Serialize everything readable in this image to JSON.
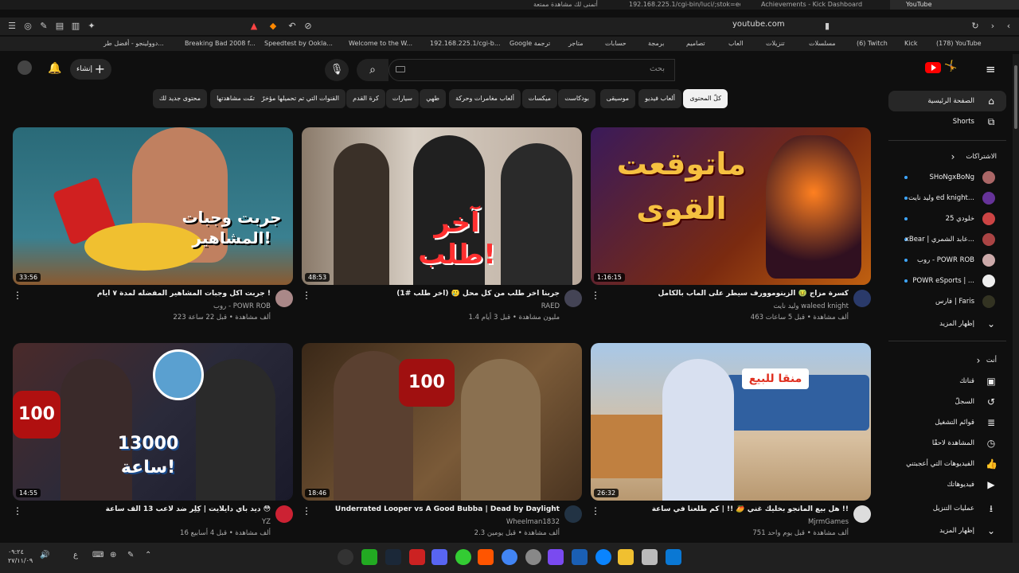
{
  "browser": {
    "tabs": [
      {
        "label": "192.168.225.1/cgi-bin/luci/;stok=ed3",
        "active": false
      },
      {
        "label": "أتمنى لك مشاهدة ممتعة",
        "active": false
      },
      {
        "label": "Achievements - Kick Dashboard",
        "active": false
      },
      {
        "label": "YouTube",
        "active": true
      }
    ],
    "url": "youtube.com",
    "bookmarks": [
      "(178) YouTube",
      "Kick",
      "(6) Twitch",
      "مسلسلات",
      "تنزيلات",
      "العاب",
      "تصاميم",
      "برمجة",
      "حسابات",
      "متاجر",
      "Google ترجمة",
      "192.168.225.1/cgi-b...",
      "Welcome to the W...",
      "Speedtest by Ookla...",
      "Breaking Bad 2008 f...",
      "دوولينجو - أفضل طر..."
    ]
  },
  "header": {
    "search_placeholder": "بحث",
    "create_label": "إنشاء"
  },
  "chips": [
    "كلّ المحتوى",
    "ألعاب فيديو",
    "موسيقى",
    "بودكاست",
    "ميكسات",
    "ألعاب مغامرات وحركة",
    "طهي",
    "سيارات",
    "كرة القدم",
    "القنوات التي تم تحميلها مؤخرًا",
    "تمّت مشاهدتها",
    "محتوى جديد لك"
  ],
  "sidebar": {
    "home": "الصفحة الرئيسية",
    "shorts": "Shorts",
    "subs_header": "الاشتراكات",
    "subscriptions": [
      "SHoNgxBoNg",
      "وليد نايت ed knight...",
      "خلودي 25",
      "xBear | عابد الشمري...",
      "روب - POWR ROB",
      "POWR eSports | ...",
      "فارس | Faris"
    ],
    "show_more": "إظهار المزيد",
    "you_header": "أنت",
    "you_items": [
      "قناتك",
      "السجلّ",
      "قوائم التشغيل",
      "المشاهدة لاحقًا",
      "الفيديوهات التي أعجبتني",
      "فيديوهاتك",
      "عمليات التنزيل"
    ],
    "show_more_2": "إظهار المزيد"
  },
  "videos": [
    {
      "title": "كسرة مزاج 🤢 الزينوموورف سيطر على الماب بالكامل",
      "channel": "وليد نايت waleed knight",
      "meta": "463 ألف مشاهدة • قبل 5 ساعات",
      "duration": "1:16:15",
      "thumb_text": "ماتوقعت القوى"
    },
    {
      "title": "جربنا آخر طلب من كل محل 🥲 (آخر طلب #1)",
      "channel": "RAED",
      "meta": "1.4 مليون مشاهدة • قبل 3 أيام",
      "duration": "48:53",
      "thumb_text": "آخر طلب!"
    },
    {
      "title": "جربت اكل وجبات المشاهير المفضله لمدة ٧ ايام !",
      "channel": "روب - POWR ROB",
      "meta": "223 ألف مشاهدة • قبل 22 ساعة",
      "duration": "33:56",
      "thumb_text": "جربت وجبات المشاهير!"
    },
    {
      "title": "هل بيع المانجو بخليك غني 🥭 !! | كم طلعنا في ساعة !!",
      "channel": "MjrmGames",
      "meta": "751 ألف مشاهدة • قبل يوم واحد",
      "duration": "26:32",
      "thumb_text": "منقا للبيع"
    },
    {
      "title": "Underrated Looper vs A Good Bubba | Dead by Daylight",
      "channel": "Wheelman1832",
      "meta": "2.3 ألف مشاهدة • قبل يومين",
      "duration": "18:46",
      "thumb_text": "100"
    },
    {
      "title": "ديد باي دايلايت | كِلِر ضد لاعب 13 الف ساعة 😳",
      "channel": "YZ",
      "meta": "16 ألف مشاهدة • قبل 4 أسابيع",
      "duration": "14:55",
      "thumb_text": "13000 ساعة!"
    }
  ],
  "taskbar": {
    "time": "٠٩:٢٤",
    "date": "٢٧/١١/٠٩",
    "lang": "ع"
  }
}
